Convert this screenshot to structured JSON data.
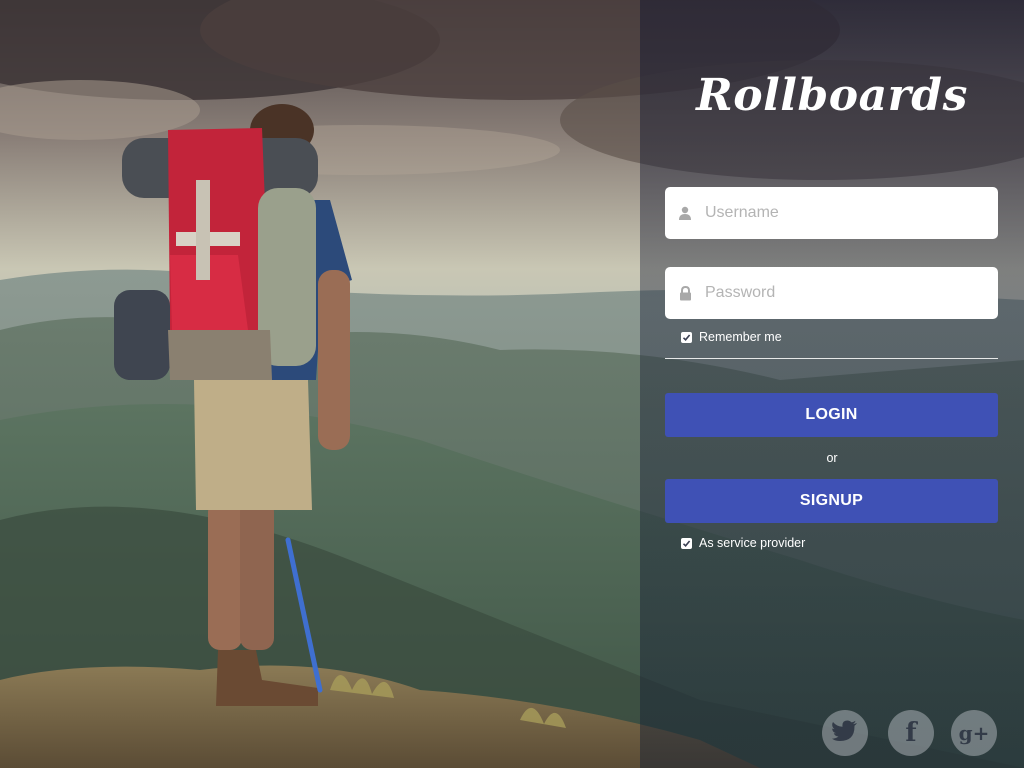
{
  "brand": {
    "title": "Rollboards"
  },
  "form": {
    "username": {
      "placeholder": "Username",
      "value": "",
      "icon": "user-icon"
    },
    "password": {
      "placeholder": "Password",
      "value": "",
      "icon": "lock-icon"
    },
    "remember_label": "Remember me",
    "remember_checked": true,
    "login_label": "LOGIN",
    "or_label": "or",
    "signup_label": "SIGNUP",
    "provider_label": "As service provider",
    "provider_checked": true
  },
  "social": {
    "twitter": {
      "icon": "twitter-icon"
    },
    "facebook": {
      "icon": "facebook-icon",
      "glyph": "f"
    },
    "google": {
      "icon": "google-plus-icon",
      "glyph": "g+"
    }
  },
  "colors": {
    "button": "#3f51b5",
    "panel_overlay": "#1e243a",
    "input_bg": "#ffffff",
    "placeholder": "#b4b4b4"
  }
}
